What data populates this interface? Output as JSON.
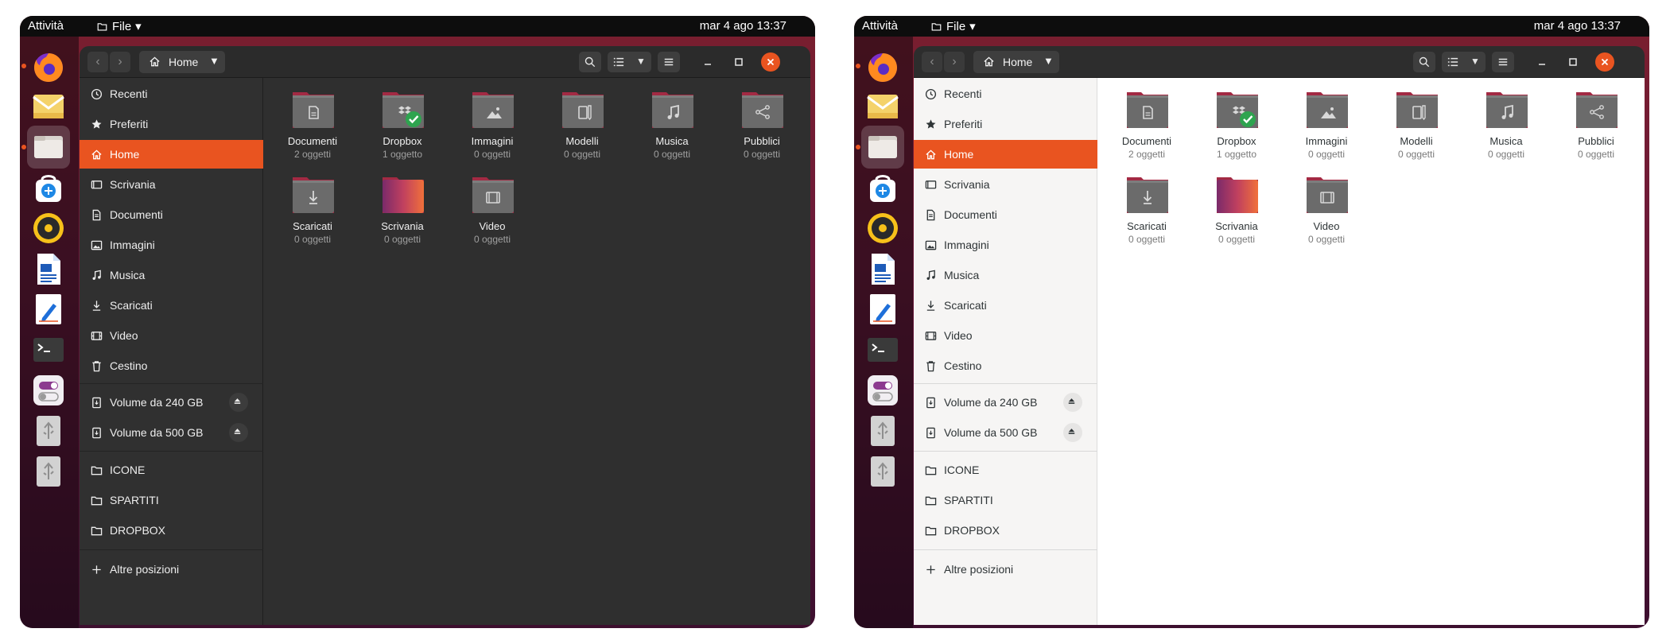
{
  "screens": {
    "dark": {
      "topbar": {
        "activities": "Attività",
        "app_menu": "File",
        "clock": "mar 4 ago  13:37"
      },
      "pathbar": {
        "location": "Home"
      },
      "sidebar": {
        "places": [
          {
            "label": "Recenti",
            "icon": "clock-icon"
          },
          {
            "label": "Preferiti",
            "icon": "star-icon"
          },
          {
            "label": "Home",
            "icon": "home-icon",
            "selected": true
          },
          {
            "label": "Scrivania",
            "icon": "desktop-icon"
          },
          {
            "label": "Documenti",
            "icon": "document-icon"
          },
          {
            "label": "Immagini",
            "icon": "image-icon"
          },
          {
            "label": "Musica",
            "icon": "music-icon"
          },
          {
            "label": "Scaricati",
            "icon": "download-icon"
          },
          {
            "label": "Video",
            "icon": "video-icon"
          },
          {
            "label": "Cestino",
            "icon": "trash-icon"
          }
        ],
        "volumes": [
          {
            "label": "Volume da 240 GB",
            "icon": "drive-icon"
          },
          {
            "label": "Volume da 500 GB",
            "icon": "drive-icon"
          }
        ],
        "bookmarks": [
          {
            "label": "ICONE",
            "icon": "folder-icon"
          },
          {
            "label": "SPARTITI",
            "icon": "folder-icon"
          },
          {
            "label": "DROPBOX",
            "icon": "folder-icon"
          }
        ],
        "other_locations": "Altre posizioni"
      },
      "folders": [
        {
          "name": "Documenti",
          "count": "2 oggetti",
          "icon": "document-folder-icon"
        },
        {
          "name": "Dropbox",
          "count": "1 oggetto",
          "icon": "dropbox-folder-icon"
        },
        {
          "name": "Immagini",
          "count": "0 oggetti",
          "icon": "image-folder-icon"
        },
        {
          "name": "Modelli",
          "count": "0 oggetti",
          "icon": "templates-folder-icon"
        },
        {
          "name": "Musica",
          "count": "0 oggetti",
          "icon": "music-folder-icon"
        },
        {
          "name": "Pubblici",
          "count": "0 oggetti",
          "icon": "share-folder-icon"
        },
        {
          "name": "Scaricati",
          "count": "0 oggetti",
          "icon": "download-folder-icon"
        },
        {
          "name": "Scrivania",
          "count": "0 oggetti",
          "icon": "desktop-folder-icon"
        },
        {
          "name": "Video",
          "count": "0 oggetti",
          "icon": "video-folder-icon"
        }
      ]
    },
    "light": {
      "topbar": {
        "activities": "Attività",
        "app_menu": "File",
        "clock": "mar 4 ago  13:37"
      },
      "pathbar": {
        "location": "Home"
      },
      "sidebar": {
        "places": [
          {
            "label": "Recenti",
            "icon": "clock-icon"
          },
          {
            "label": "Preferiti",
            "icon": "star-icon"
          },
          {
            "label": "Home",
            "icon": "home-icon",
            "selected": true
          },
          {
            "label": "Scrivania",
            "icon": "desktop-icon"
          },
          {
            "label": "Documenti",
            "icon": "document-icon"
          },
          {
            "label": "Immagini",
            "icon": "image-icon"
          },
          {
            "label": "Musica",
            "icon": "music-icon"
          },
          {
            "label": "Scaricati",
            "icon": "download-icon"
          },
          {
            "label": "Video",
            "icon": "video-icon"
          },
          {
            "label": "Cestino",
            "icon": "trash-icon"
          }
        ],
        "volumes": [
          {
            "label": "Volume da 240 GB",
            "icon": "drive-icon"
          },
          {
            "label": "Volume da 500 GB",
            "icon": "drive-icon"
          }
        ],
        "bookmarks": [
          {
            "label": "ICONE",
            "icon": "folder-icon"
          },
          {
            "label": "SPARTITI",
            "icon": "folder-icon"
          },
          {
            "label": "DROPBOX",
            "icon": "folder-icon"
          }
        ],
        "other_locations": "Altre posizioni"
      },
      "folders": [
        {
          "name": "Documenti",
          "count": "2 oggetti",
          "icon": "document-folder-icon"
        },
        {
          "name": "Dropbox",
          "count": "1 oggetto",
          "icon": "dropbox-folder-icon"
        },
        {
          "name": "Immagini",
          "count": "0 oggetti",
          "icon": "image-folder-icon"
        },
        {
          "name": "Modelli",
          "count": "0 oggetti",
          "icon": "templates-folder-icon"
        },
        {
          "name": "Musica",
          "count": "0 oggetti",
          "icon": "music-folder-icon"
        },
        {
          "name": "Pubblici",
          "count": "0 oggetti",
          "icon": "share-folder-icon"
        },
        {
          "name": "Scaricati",
          "count": "0 oggetti",
          "icon": "download-folder-icon"
        },
        {
          "name": "Scrivania",
          "count": "0 oggetti",
          "icon": "desktop-folder-icon"
        },
        {
          "name": "Video",
          "count": "0 oggetti",
          "icon": "video-folder-icon"
        }
      ]
    }
  },
  "dock": [
    {
      "name": "firefox-icon",
      "running": true
    },
    {
      "name": "mail-icon",
      "running": false
    },
    {
      "name": "files-icon",
      "running": true,
      "active": true
    },
    {
      "name": "software-store-icon",
      "running": false
    },
    {
      "name": "rhythmbox-icon",
      "running": false
    },
    {
      "name": "writer-icon",
      "running": false
    },
    {
      "name": "text-editor-icon",
      "running": false
    },
    {
      "name": "terminal-icon",
      "running": false
    },
    {
      "name": "settings-toggle-icon",
      "running": false
    },
    {
      "name": "usb-drive-icon",
      "running": false
    },
    {
      "name": "usb-drive-icon",
      "running": false
    }
  ],
  "colors": {
    "accent": "#e95420",
    "folder_top": "#a32a43",
    "folder_body_dark": "#6b6b6b",
    "dropbox_check": "#2ea44f"
  }
}
